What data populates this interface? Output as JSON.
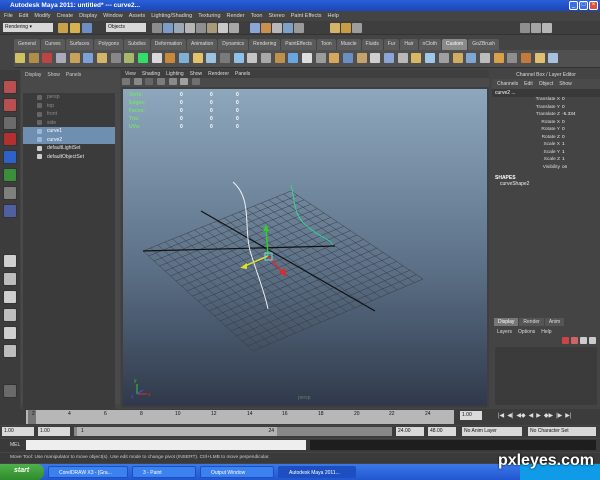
{
  "window": {
    "title": "Autodesk Maya 2011: untitled*   ---   curve2..."
  },
  "menu": [
    "File",
    "Edit",
    "Modify",
    "Create",
    "Display",
    "Window",
    "Assets",
    "Lighting/Shading",
    "Texturing",
    "Render",
    "Toon",
    "Stereo",
    "Paint Effects",
    "Help"
  ],
  "status": {
    "mode": "Rendering",
    "selection": "Objects"
  },
  "shelf_tabs": [
    "General",
    "Curves",
    "Surfaces",
    "Polygons",
    "Subdivs",
    "Deformation",
    "Animation",
    "Dynamics",
    "Rendering",
    "PaintEffects",
    "Toon",
    "Muscle",
    "Fluids",
    "Fur",
    "Hair",
    "nCloth",
    "Custom",
    "GoZBrush"
  ],
  "shelf_active": "Custom",
  "outliner": {
    "menu": [
      "Display",
      "Show",
      "Panels"
    ],
    "items": [
      {
        "label": "persp",
        "state": "dim"
      },
      {
        "label": "top",
        "state": "dim"
      },
      {
        "label": "front",
        "state": "dim"
      },
      {
        "label": "side",
        "state": "dim"
      },
      {
        "label": "curve1",
        "state": "sel"
      },
      {
        "label": "curve2",
        "state": "sel"
      },
      {
        "label": "defaultLightSet",
        "state": "set"
      },
      {
        "label": "defaultObjectSet",
        "state": "set"
      }
    ]
  },
  "viewport": {
    "menu": [
      "View",
      "Shading",
      "Lighting",
      "Show",
      "Renderer",
      "Panels"
    ],
    "hud": [
      {
        "label": "Verts:",
        "values": [
          "0",
          "0",
          "0"
        ]
      },
      {
        "label": "Edges:",
        "values": [
          "0",
          "0",
          "0"
        ]
      },
      {
        "label": "Faces:",
        "values": [
          "0",
          "0",
          "0"
        ]
      },
      {
        "label": "Tris:",
        "values": [
          "0",
          "0",
          "0"
        ]
      },
      {
        "label": "UVs:",
        "values": [
          "0",
          "0",
          "0"
        ]
      }
    ],
    "camera": "persp",
    "axis": {
      "x": "x",
      "y": "y",
      "z": "z"
    }
  },
  "channel_box": {
    "title": "Channel Box / Layer Editor",
    "menu": [
      "Channels",
      "Edit",
      "Object",
      "Show"
    ],
    "object": "curve2 ...",
    "attrs": [
      {
        "name": "Translate X",
        "value": "0"
      },
      {
        "name": "Translate Y",
        "value": "0"
      },
      {
        "name": "Translate Z",
        "value": "-5.334"
      },
      {
        "name": "Rotate X",
        "value": "0"
      },
      {
        "name": "Rotate Y",
        "value": "0"
      },
      {
        "name": "Rotate Z",
        "value": "0"
      },
      {
        "name": "Scale X",
        "value": "1"
      },
      {
        "name": "Scale Y",
        "value": "1"
      },
      {
        "name": "Scale Z",
        "value": "1"
      },
      {
        "name": "Visibility",
        "value": "on"
      }
    ],
    "shapes_header": "SHAPES",
    "shape": "curveShape2",
    "layer_tabs": [
      "Display",
      "Render",
      "Anim"
    ],
    "layer_menu": [
      "Layers",
      "Options",
      "Help"
    ]
  },
  "timeline": {
    "ticks": [
      "2",
      "4",
      "6",
      "8",
      "10",
      "12",
      "14",
      "16",
      "18",
      "20",
      "22",
      "24"
    ],
    "current": "1.00"
  },
  "range": {
    "start": "1.00",
    "inner_start": "1.00",
    "current": "1",
    "inner_end": "24",
    "end": "24.00",
    "playback_end": "48.00",
    "anim_layer": "No Anim Layer",
    "char_set": "No Character Set"
  },
  "mel": {
    "label": "MEL"
  },
  "help": "Move Tool: Use manipulator to move object(s). Use edit mode to change pivot (INSERT). Ctrl+LMB to move perpendicular.",
  "taskbar": {
    "start": "start",
    "tasks": [
      "CorelDRAW X3 - [Gra...",
      "3 - Paint",
      "Output Window",
      "Autodesk Maya 2011..."
    ]
  },
  "watermark": "pxleyes.com"
}
